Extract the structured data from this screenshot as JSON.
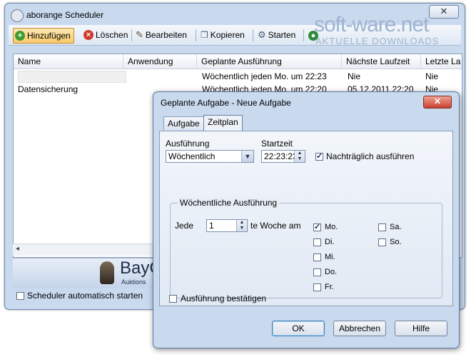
{
  "main_window": {
    "title": "aborange Scheduler",
    "toolbar": [
      {
        "label": "Hinzufügen",
        "icon": "add-icon"
      },
      {
        "label": "Löschen",
        "icon": "delete-icon"
      },
      {
        "label": "Bearbeiten",
        "icon": "edit-icon"
      },
      {
        "label": "Kopieren",
        "icon": "copy-icon"
      },
      {
        "label": "Starten",
        "icon": "start-icon"
      }
    ],
    "columns": [
      "Name",
      "Anwendung",
      "Geplante Ausführung",
      "Nächste Laufzeit",
      "Letzte La"
    ],
    "rows": [
      {
        "name": "",
        "app": "",
        "schedule": "Wöchentlich jeden Mo. um 22:23",
        "next": "Nie",
        "last": "Nie"
      },
      {
        "name": "Datensicherung",
        "app": "",
        "schedule": "Wöchentlich jeden Mo. um 22:20",
        "next": "05.12.2011 22:20",
        "last": "Nie"
      }
    ],
    "banner_brand": "BayC",
    "banner_sub": "Auktions",
    "auto_start_label": "Scheduler automatisch starten",
    "auto_start_checked": false
  },
  "watermark": {
    "text": "soft-ware.net",
    "sub": "AKTUELLE DOWNLOADS"
  },
  "dialog": {
    "title": "Geplante Aufgabe - Neue Aufgabe",
    "tabs": [
      "Aufgabe",
      "Zeitplan"
    ],
    "selected_tab": "Zeitplan",
    "ausfuehrung_label": "Ausführung",
    "ausfuehrung_value": "Wöchentlich",
    "startzeit_label": "Startzeit",
    "startzeit_value": "22:23:23",
    "nachtraeglich_label": "Nachträglich ausführen",
    "nachtraeglich_checked": true,
    "group_label": "Wöchentliche Ausführung",
    "jede_label": "Jede",
    "jede_value": "1",
    "woche_label": "te Woche am",
    "days": [
      {
        "label": "Mo.",
        "checked": true
      },
      {
        "label": "Di.",
        "checked": false
      },
      {
        "label": "Mi.",
        "checked": false
      },
      {
        "label": "Do.",
        "checked": false
      },
      {
        "label": "Fr.",
        "checked": false
      },
      {
        "label": "Sa.",
        "checked": false
      },
      {
        "label": "So.",
        "checked": false
      }
    ],
    "bestaetigen_label": "Ausführung bestätigen",
    "bestaetigen_checked": false,
    "buttons": {
      "ok": "OK",
      "cancel": "Abbrechen",
      "help": "Hilfe"
    }
  }
}
